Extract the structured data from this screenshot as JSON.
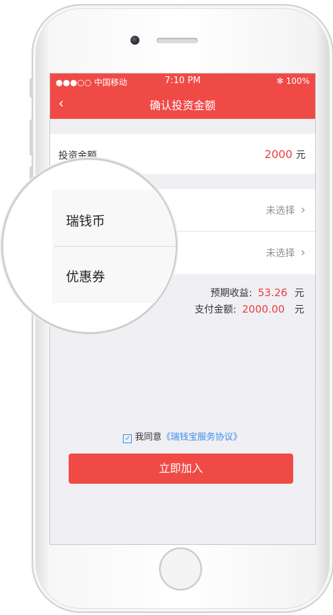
{
  "status": {
    "carrier": "●●●○○ 中国移动",
    "time": "7:10 PM",
    "battery": "✻ 100%"
  },
  "nav": {
    "back_icon": "‹",
    "title": "确认投资金额"
  },
  "investment": {
    "label": "投资金额",
    "amount": "2000",
    "unit": "元"
  },
  "options": {
    "coin_value": "未选择",
    "coupon_value": "未选择",
    "chevron": "›"
  },
  "magnifier": {
    "coin_label": "瑞钱币",
    "coupon_label": "优惠券"
  },
  "summary": {
    "expected_label": "预期收益:",
    "expected_value": "53.26",
    "pay_label": "支付金额:",
    "pay_value": "2000.00",
    "unit": "元"
  },
  "agreement": {
    "checked_icon": "✓",
    "prefix": "我同意",
    "link": "《瑞钱宝服务协议》"
  },
  "join_button": "立即加入",
  "colors": {
    "accent": "#f04a47",
    "link": "#3a8ee6"
  }
}
